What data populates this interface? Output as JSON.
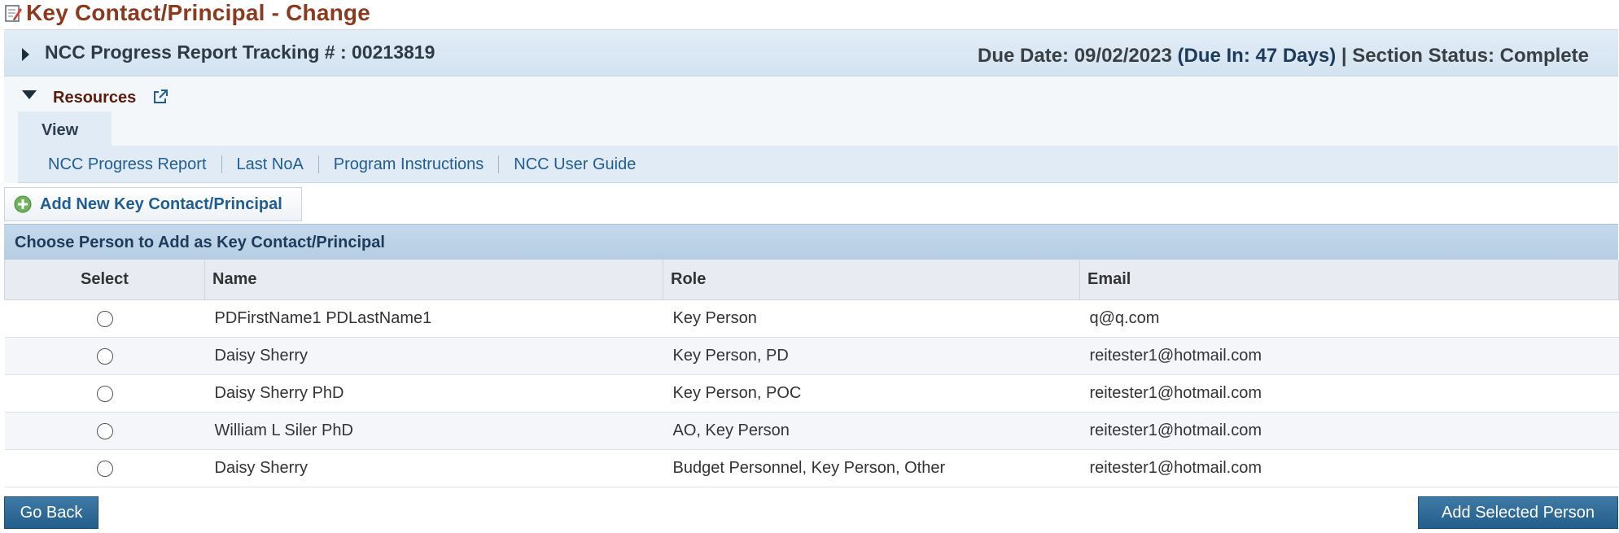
{
  "page": {
    "title": "Key Contact/Principal - Change"
  },
  "tracking": {
    "label": "NCC Progress Report Tracking # : 00213819",
    "due_date": "Due Date: 09/02/2023",
    "due_in": "(Due In: 47 Days)",
    "separator": " | ",
    "section_status": "Section Status: Complete"
  },
  "resources": {
    "label": "Resources",
    "view_tab": "View",
    "links": [
      "NCC Progress Report",
      "Last NoA",
      "Program Instructions",
      "NCC User Guide"
    ]
  },
  "actions": {
    "add_new": "Add New Key Contact/Principal",
    "go_back": "Go Back",
    "add_selected": "Add Selected Person"
  },
  "section": {
    "title": "Choose Person to Add as Key Contact/Principal"
  },
  "table": {
    "headers": [
      "Select",
      "Name",
      "Role",
      "Email"
    ],
    "rows": [
      {
        "name": "PDFirstName1 PDLastName1",
        "role": "Key Person",
        "email": "q@q.com"
      },
      {
        "name": "Daisy Sherry",
        "role": "Key Person, PD",
        "email": "reitester1@hotmail.com"
      },
      {
        "name": "Daisy Sherry PhD",
        "role": "Key Person, POC",
        "email": "reitester1@hotmail.com"
      },
      {
        "name": "William L Siler PhD",
        "role": "AO, Key Person",
        "email": "reitester1@hotmail.com"
      },
      {
        "name": "Daisy Sherry",
        "role": "Budget Personnel, Key Person, Other",
        "email": "reitester1@hotmail.com"
      }
    ]
  },
  "icons": {
    "title": "edit-document-icon",
    "tracking_toggle": "caret-right-icon",
    "resources_toggle": "caret-down-icon",
    "resources_link": "external-link-icon",
    "add_new": "plus-circle-icon"
  },
  "colors": {
    "title": "#8b3a1e",
    "link": "#1f5d92",
    "section_header": "#b5cde3",
    "button": "#235e8c"
  }
}
